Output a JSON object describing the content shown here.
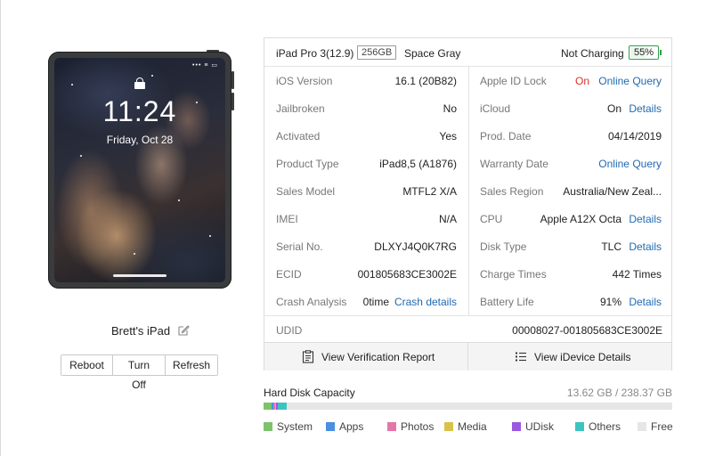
{
  "device": {
    "lock_time": "11:24",
    "lock_date": "Friday, Oct 28",
    "status_icons": "••• ≡ ▭",
    "name": "Brett's iPad",
    "buttons": {
      "reboot": "Reboot",
      "turn_off": "Turn Off",
      "refresh": "Refresh"
    }
  },
  "header": {
    "model": "iPad Pro 3(12.9)",
    "capacity": "256GB",
    "color": "Space Gray",
    "charging_status": "Not Charging",
    "battery_percent": 55,
    "battery_label": "55%"
  },
  "left_rows": [
    {
      "label": "iOS Version",
      "value": "16.1 (20B82)"
    },
    {
      "label": "Jailbroken",
      "value": "No"
    },
    {
      "label": "Activated",
      "value": "Yes"
    },
    {
      "label": "Product Type",
      "value": "iPad8,5 (A1876)"
    },
    {
      "label": "Sales Model",
      "value": "MTFL2 X/A"
    },
    {
      "label": "IMEI",
      "value": "N/A"
    },
    {
      "label": "Serial No.",
      "value": "DLXYJ4Q0K7RG"
    },
    {
      "label": "ECID",
      "value": "001805683CE3002E"
    },
    {
      "label": "Crash Analysis",
      "value": "0time",
      "link": "Crash details"
    }
  ],
  "right_rows": [
    {
      "label": "Apple ID Lock",
      "status": "On",
      "link": "Online Query"
    },
    {
      "label": "iCloud",
      "value": "On",
      "link": "Details"
    },
    {
      "label": "Prod. Date",
      "value": "04/14/2019"
    },
    {
      "label": "Warranty Date",
      "link": "Online Query"
    },
    {
      "label": "Sales Region",
      "value": "Australia/New Zeal..."
    },
    {
      "label": "CPU",
      "value": "Apple A12X Octa",
      "link": "Details"
    },
    {
      "label": "Disk Type",
      "value": "TLC",
      "link": "Details"
    },
    {
      "label": "Charge Times",
      "value": "442 Times"
    },
    {
      "label": "Battery Life",
      "value": "91%",
      "link": "Details"
    }
  ],
  "udid": {
    "label": "UDID",
    "value": "00008027-001805683CE3002E"
  },
  "footer": {
    "verification": "View Verification Report",
    "details": "View iDevice Details"
  },
  "disk": {
    "title": "Hard Disk Capacity",
    "size": "13.62 GB / 238.37 GB",
    "segments": [
      {
        "name": "System",
        "color": "#7dc36b",
        "fraction": 0.019
      },
      {
        "name": "Apps",
        "color": "#4a8fe0",
        "fraction": 0.006
      },
      {
        "name": "Photos",
        "color": "#e377a8",
        "fraction": 0.004
      },
      {
        "name": "Media",
        "color": "#d9c24a",
        "fraction": 0.002
      },
      {
        "name": "UDisk",
        "color": "#9b59e0",
        "fraction": 0.003
      },
      {
        "name": "Others",
        "color": "#3cc4c0",
        "fraction": 0.023
      },
      {
        "name": "Free",
        "color": "#e6e6e6",
        "fraction": 0.943
      }
    ]
  }
}
